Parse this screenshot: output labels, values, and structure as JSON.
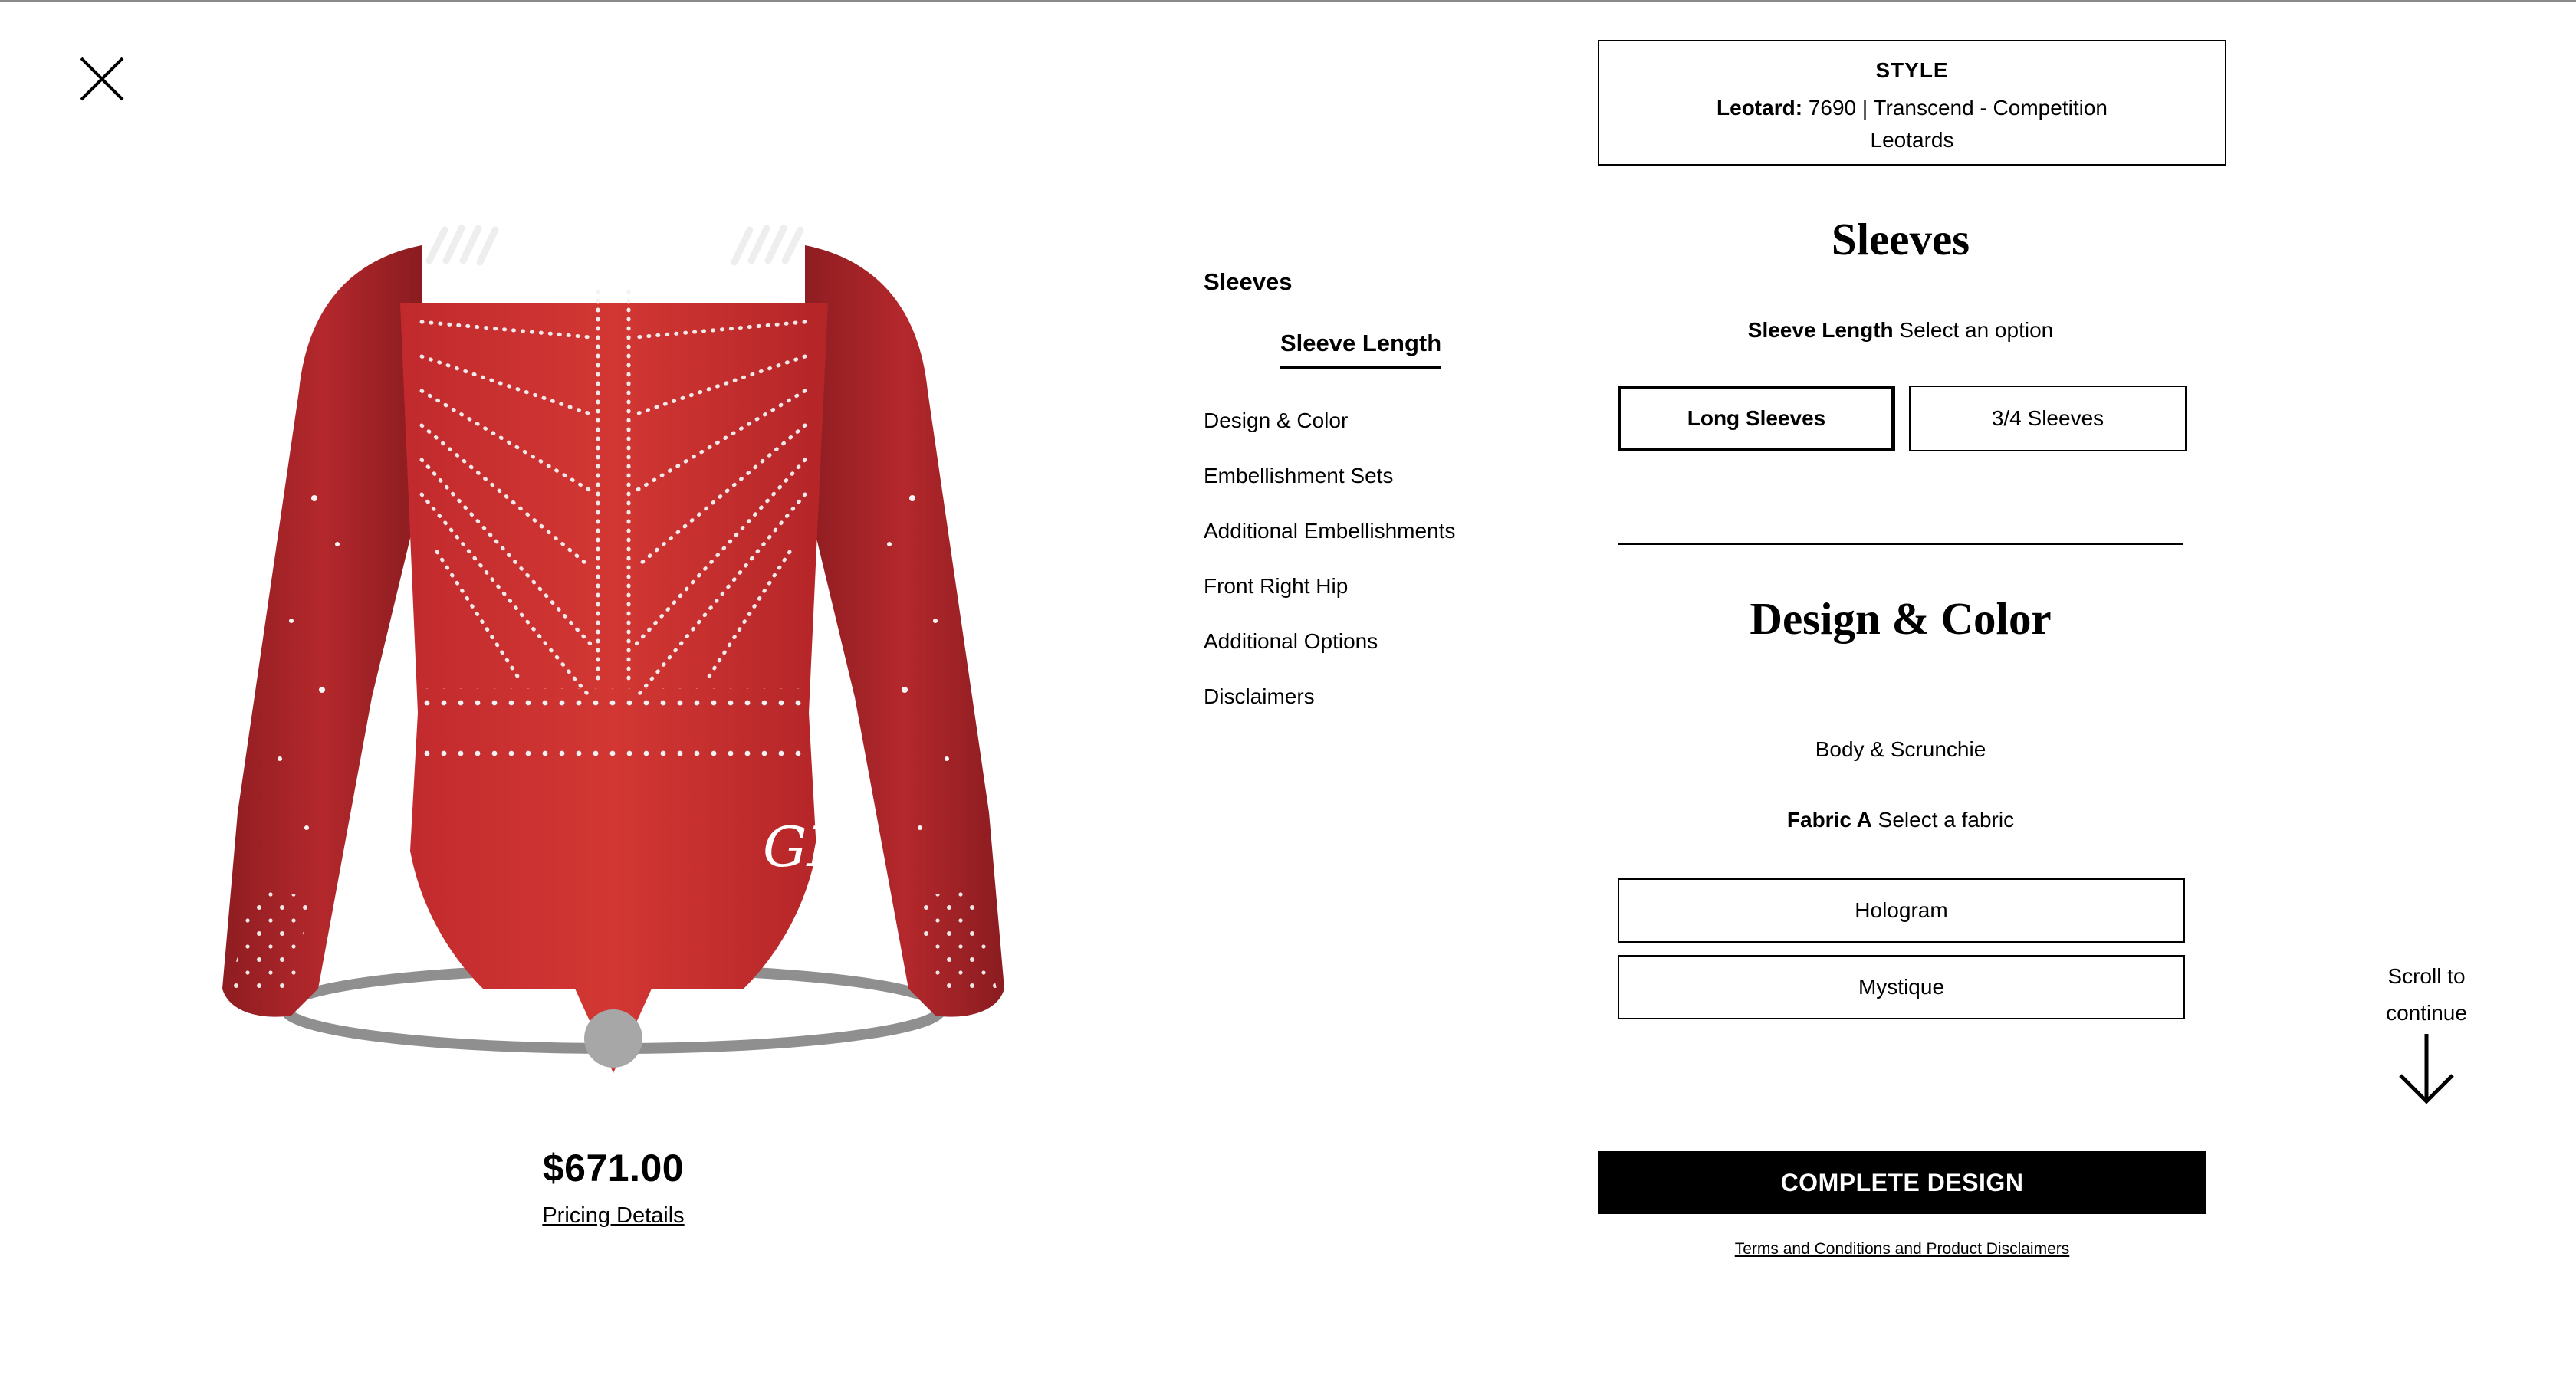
{
  "close": {
    "icon": "close-icon"
  },
  "product": {
    "price": "$671.00",
    "pricing_link": "Pricing Details",
    "logo_text": "GK",
    "colors": {
      "fabric": "#b8262a",
      "sleeve": "#9a2226",
      "rhinestone": "#f3f3f3"
    }
  },
  "nav": {
    "section": "Sleeves",
    "active_sub": "Sleeve Length",
    "items": [
      {
        "label": "Design & Color"
      },
      {
        "label": "Embellishment Sets"
      },
      {
        "label": "Additional Embellishments"
      },
      {
        "label": "Front Right Hip"
      },
      {
        "label": "Additional Options"
      },
      {
        "label": "Disclaimers"
      }
    ]
  },
  "style": {
    "title": "STYLE",
    "label": "Leotard:",
    "value": "7690 | Transcend - Competition Leotards"
  },
  "sleeves": {
    "heading": "Sleeves",
    "option_label": "Sleeve Length",
    "option_prompt": "Select an option",
    "options": [
      {
        "label": "Long Sleeves",
        "selected": true
      },
      {
        "label": "3/4 Sleeves",
        "selected": false
      }
    ]
  },
  "design": {
    "heading": "Design & Color",
    "group": "Body & Scrunchie",
    "fabric_label": "Fabric A",
    "fabric_prompt": "Select a fabric",
    "fabrics": [
      {
        "label": "Hologram"
      },
      {
        "label": "Mystique"
      }
    ]
  },
  "scroll_hint": {
    "line1": "Scroll to",
    "line2": "continue",
    "icon": "arrow-down-icon"
  },
  "complete_button": "COMPLETE DESIGN",
  "terms_link": "Terms and Conditions and Product Disclaimers"
}
